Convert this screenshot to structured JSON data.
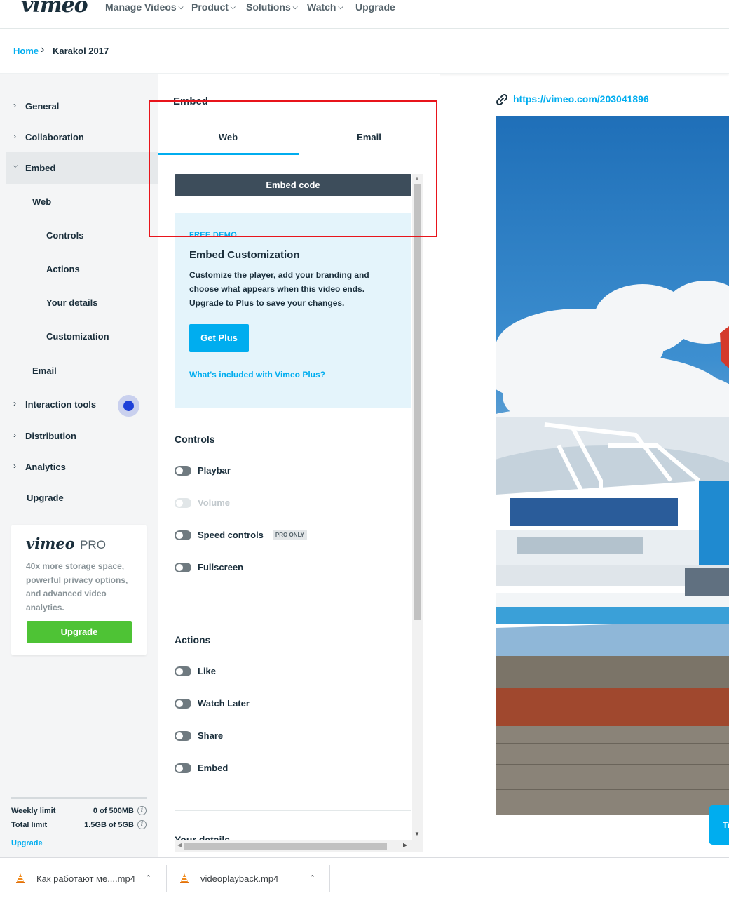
{
  "topnav": {
    "logo": "vimeo",
    "items": [
      {
        "label": "Manage Videos",
        "has_caret": true
      },
      {
        "label": "Product",
        "has_caret": true
      },
      {
        "label": "Solutions",
        "has_caret": true
      },
      {
        "label": "Watch",
        "has_caret": true
      },
      {
        "label": "Upgrade",
        "has_caret": false
      }
    ]
  },
  "breadcrumb": {
    "home": "Home",
    "current": "Karakol 2017"
  },
  "sidebar": {
    "items": [
      {
        "label": "General",
        "expandable": true
      },
      {
        "label": "Collaboration",
        "expandable": true
      },
      {
        "label": "Embed",
        "expandable": true,
        "expanded": true
      },
      {
        "label": "Web"
      },
      {
        "label": "Controls"
      },
      {
        "label": "Actions"
      },
      {
        "label": "Your details"
      },
      {
        "label": "Customization"
      },
      {
        "label": "Email"
      },
      {
        "label": "Interaction tools",
        "expandable": true
      },
      {
        "label": "Distribution",
        "expandable": true
      },
      {
        "label": "Analytics",
        "expandable": true
      },
      {
        "label": "Upgrade"
      }
    ],
    "pro_card": {
      "logo": "vimeo",
      "logo_suffix": "PRO",
      "text": "40x more storage space, powerful privacy options, and advanced video analytics.",
      "button": "Upgrade"
    },
    "limits": {
      "weekly_label": "Weekly limit",
      "weekly_value": "0 of 500MB",
      "total_label": "Total limit",
      "total_value": "1.5GB of 5GB",
      "upgrade": "Upgrade"
    }
  },
  "embed_panel": {
    "title": "Embed",
    "tabs": [
      {
        "label": "Web",
        "active": true
      },
      {
        "label": "Email",
        "active": false
      }
    ],
    "embed_code_button": "Embed code",
    "demo": {
      "tag": "FREE DEMO",
      "title": "Embed Customization",
      "text": "Customize the player, add your branding and choose what appears when this video ends. Upgrade to Plus to save your changes.",
      "button": "Get Plus",
      "link": "What's included with Vimeo Plus?"
    },
    "controls": {
      "title": "Controls",
      "toggles": [
        {
          "label": "Playbar",
          "enabled": true
        },
        {
          "label": "Volume",
          "enabled": false
        },
        {
          "label": "Speed controls",
          "enabled": true,
          "badge": "PRO ONLY"
        },
        {
          "label": "Fullscreen",
          "enabled": true
        }
      ]
    },
    "actions": {
      "title": "Actions",
      "toggles": [
        {
          "label": "Like"
        },
        {
          "label": "Watch Later"
        },
        {
          "label": "Share"
        },
        {
          "label": "Embed"
        }
      ]
    },
    "next_section": "Your details"
  },
  "preview": {
    "url": "https://vimeo.com/203041896",
    "side_tab": "Ti"
  },
  "downloads": [
    {
      "name": "Как работают ме....mp4"
    },
    {
      "name": "videoplayback.mp4"
    }
  ],
  "colors": {
    "accent": "#00adef",
    "highlight": "#e8141b",
    "upgrade_green": "#4ec335",
    "dark_button": "#3d4d5b"
  }
}
